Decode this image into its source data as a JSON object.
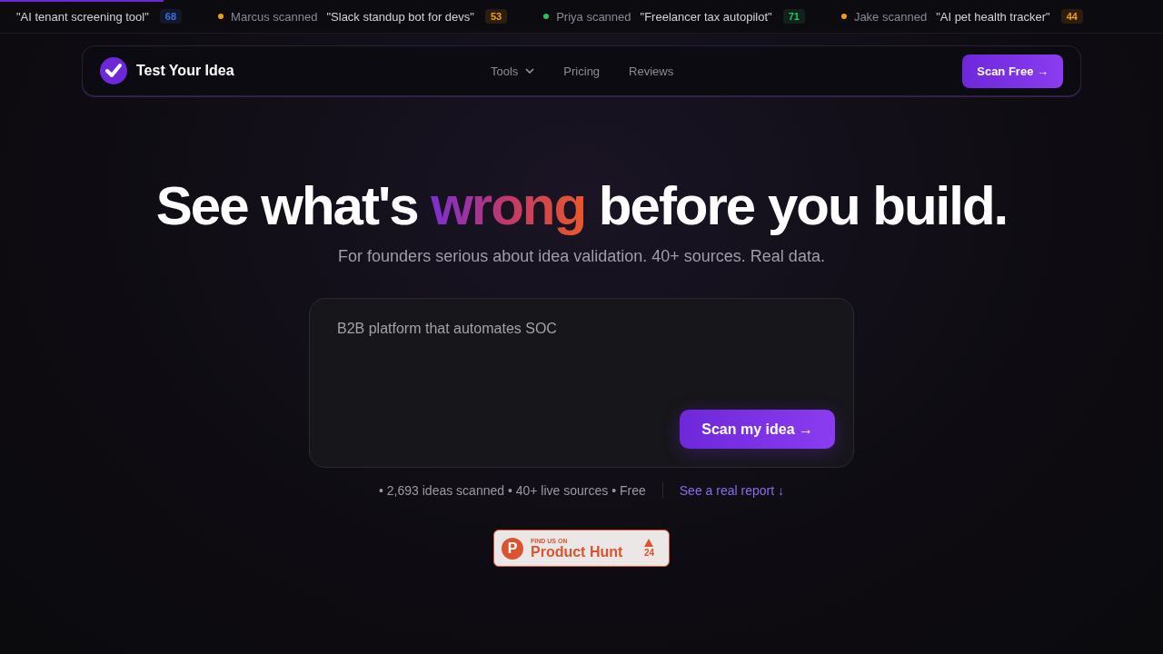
{
  "ticker": [
    {
      "idea": "\"AI tenant screening tool\"",
      "score": "68",
      "dot": false,
      "color": "#3b6fe0"
    },
    {
      "name": "Marcus",
      "action": "scanned",
      "idea": "\"Slack standup bot for devs\"",
      "score": "53",
      "dot": true,
      "color": "#f59e0b"
    },
    {
      "name": "Priya",
      "action": "scanned",
      "idea": "\"Freelancer tax autopilot\"",
      "score": "71",
      "dot": true,
      "color": "#22c55e"
    },
    {
      "name": "Jake",
      "action": "scanned",
      "idea": "\"AI pet health tracker\"",
      "score": "44",
      "dot": true,
      "color": "#f59e0b"
    }
  ],
  "nav": {
    "brand": "Test Your Idea",
    "links": [
      {
        "label": "Tools",
        "kind": "dropdown"
      },
      {
        "label": "Pricing",
        "kind": "link"
      },
      {
        "label": "Reviews",
        "kind": "link"
      }
    ],
    "cta": "Scan Free →"
  },
  "hero": {
    "headline_before": "See what's ",
    "headline_highlight": "wrong",
    "headline_after": " before you build.",
    "subtitle": "For founders serious about idea validation. 40+ sources. Real data."
  },
  "idea_input": {
    "value": "B2B platform that automates SOC",
    "button": "Scan my idea →"
  },
  "stats": {
    "text": "• 2,693 ideas scanned • 40+ live sources • Free",
    "link": "See a real report ↓"
  },
  "badge": {
    "logo_letter": "P",
    "kicker": "FIND US ON",
    "name": "Product Hunt",
    "votes": "24"
  }
}
